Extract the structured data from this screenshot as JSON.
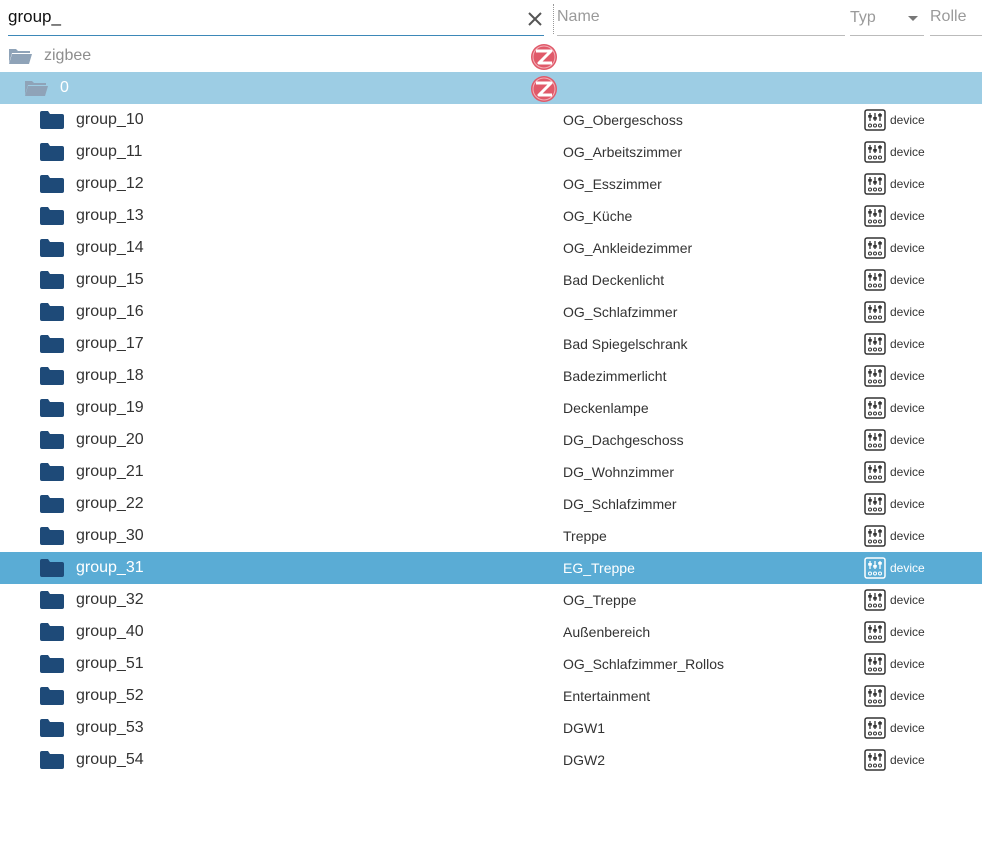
{
  "filters": {
    "id_value": "group_",
    "name_placeholder": "Name",
    "type_label": "Typ",
    "role_placeholder": "Rolle"
  },
  "tree": {
    "root": {
      "label": "zigbee",
      "icon": "folder-open-icon",
      "adapter_icon": "zigbee-logo-icon"
    },
    "instance": {
      "label": "0",
      "icon": "folder-open-icon",
      "adapter_icon": "zigbee-logo-icon"
    },
    "rows": [
      {
        "id": "group_10",
        "name": "OG_Obergeschoss",
        "type": "device"
      },
      {
        "id": "group_11",
        "name": "OG_Arbeitszimmer",
        "type": "device"
      },
      {
        "id": "group_12",
        "name": "OG_Esszimmer",
        "type": "device"
      },
      {
        "id": "group_13",
        "name": "OG_Küche",
        "type": "device"
      },
      {
        "id": "group_14",
        "name": "OG_Ankleidezimmer",
        "type": "device"
      },
      {
        "id": "group_15",
        "name": "Bad Deckenlicht",
        "type": "device"
      },
      {
        "id": "group_16",
        "name": "OG_Schlafzimmer",
        "type": "device"
      },
      {
        "id": "group_17",
        "name": "Bad Spiegelschrank",
        "type": "device"
      },
      {
        "id": "group_18",
        "name": "Badezimmerlicht",
        "type": "device"
      },
      {
        "id": "group_19",
        "name": "Deckenlampe",
        "type": "device"
      },
      {
        "id": "group_20",
        "name": "DG_Dachgeschoss",
        "type": "device"
      },
      {
        "id": "group_21",
        "name": "DG_Wohnzimmer",
        "type": "device"
      },
      {
        "id": "group_22",
        "name": "DG_Schlafzimmer",
        "type": "device"
      },
      {
        "id": "group_30",
        "name": "Treppe",
        "type": "device"
      },
      {
        "id": "group_31",
        "name": "EG_Treppe",
        "type": "device",
        "selected": true
      },
      {
        "id": "group_32",
        "name": "OG_Treppe",
        "type": "device"
      },
      {
        "id": "group_40",
        "name": "Außenbereich",
        "type": "device"
      },
      {
        "id": "group_51",
        "name": "OG_Schlafzimmer_Rollos",
        "type": "device"
      },
      {
        "id": "group_52",
        "name": "Entertainment",
        "type": "device"
      },
      {
        "id": "group_53",
        "name": "DGW1",
        "type": "device"
      },
      {
        "id": "group_54",
        "name": "DGW2",
        "type": "device"
      }
    ]
  },
  "colors": {
    "folder": "#1e4a78",
    "folder_open": "#8fa3b8",
    "selected_row": "#5aacd5",
    "selected_parent_row": "#9dcde4",
    "zigbee_red": "#e05060"
  }
}
